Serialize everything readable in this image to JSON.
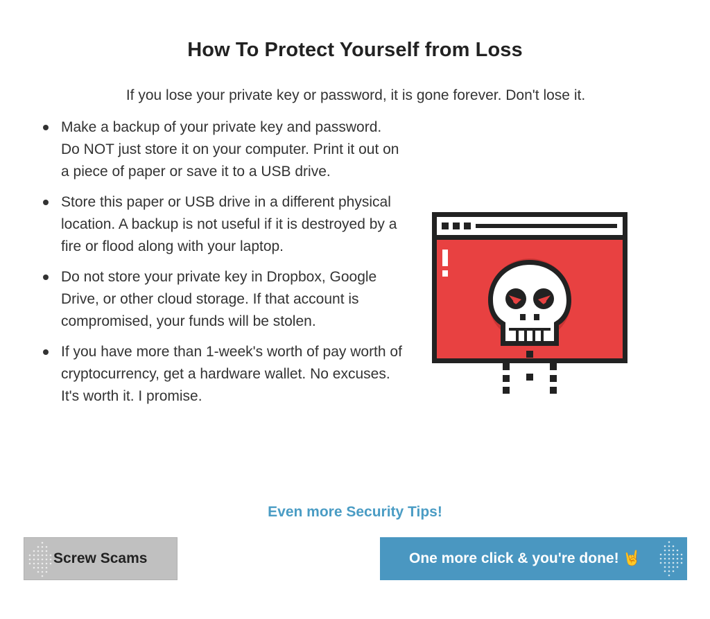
{
  "page": {
    "title": "How To Protect Yourself from Loss",
    "intro": "If you lose your private key or password, it is gone forever. Don't lose it."
  },
  "tips": [
    "Make a backup of your private key and password. Do NOT just store it on your computer. Print it out on a piece of paper or save it to a USB drive.",
    "Store this paper or USB drive in a different physical location. A backup is not useful if it is destroyed by a fire or flood along with your laptop.",
    "Do not store your private key in Dropbox, Google Drive, or other cloud storage. If that account is compromised, your funds will be stolen.",
    "If you have more than 1-week's worth of pay worth of cryptocurrency, get a hardware wallet. No excuses. It's worth it. I promise."
  ],
  "illustration": {
    "icon": "browser-window-skull-icon"
  },
  "links": {
    "more_tips": "Even more Security Tips!"
  },
  "buttons": {
    "secondary_label": "Screw Scams",
    "primary_label": "One more click & you're done! 🤘"
  },
  "colors": {
    "link": "#4a9cc4",
    "primary_button": "#4a97c1",
    "secondary_button": "#c0c0c0",
    "alert_red": "#e84141"
  }
}
